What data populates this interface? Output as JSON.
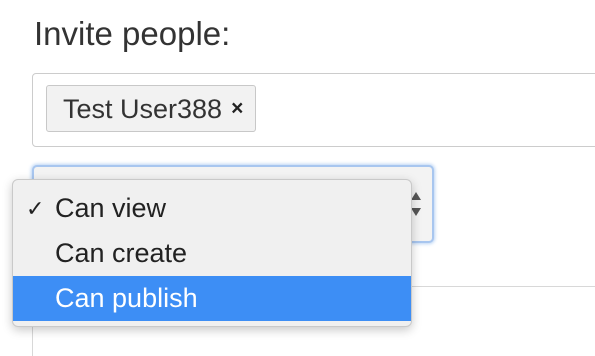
{
  "invite": {
    "heading": "Invite people:",
    "tokens": [
      {
        "label": "Test User388",
        "remove_glyph": "×"
      }
    ]
  },
  "permission_select": {
    "selected_value": "Can view",
    "focus_ring_color": "#a8c6ef",
    "options": [
      {
        "label": "Can view",
        "checked": true,
        "highlighted": false
      },
      {
        "label": "Can create",
        "checked": false,
        "highlighted": false
      },
      {
        "label": "Can publish",
        "checked": false,
        "highlighted": true
      }
    ],
    "check_glyph": "✓",
    "highlight_color": "#3d8ef5"
  },
  "icons": {
    "token_remove": "close-icon",
    "select_arrows": "chevron-up-down-icon",
    "checkmark": "check-icon"
  }
}
